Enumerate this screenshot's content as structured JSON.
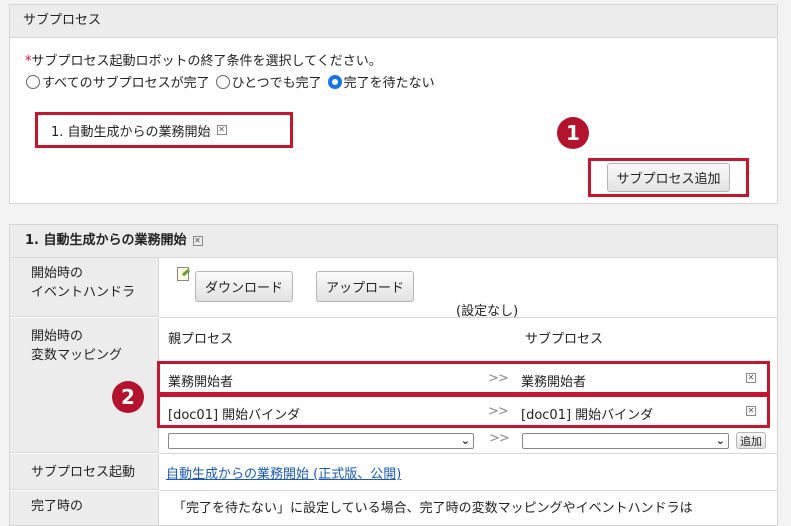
{
  "section1": {
    "title": "サブプロセス",
    "required_mark": "*",
    "prompt": "サブプロセス起動ロボットの終了条件を選択してください。",
    "radio_options": [
      {
        "label": "すべてのサブプロセスが完了",
        "checked": false
      },
      {
        "label": "ひとつでも完了",
        "checked": false
      },
      {
        "label": "完了を待たない",
        "checked": true
      }
    ],
    "listed_subprocess": "1. 自動生成からの業務開始",
    "add_button": "サブプロセス追加"
  },
  "badges": {
    "one": "1",
    "two": "2"
  },
  "section2": {
    "title": "1. 自動生成からの業務開始",
    "event_handler_label": "開始時の\nイベントハンドラ",
    "download_button": "ダウンロード",
    "upload_button": "アップロード",
    "no_setting": "(設定なし)",
    "mapping_label": "開始時の\n変数マッピング",
    "parent_header": "親プロセス",
    "sub_header": "サブプロセス",
    "mappings": [
      {
        "parent": "業務開始者",
        "arrow": ">>",
        "sub": "業務開始者"
      },
      {
        "parent": "[doc01] 開始バインダ",
        "arrow": ">>",
        "sub": "[doc01] 開始バインダ"
      }
    ],
    "new_mapping_arrow": ">>",
    "add_small_button": "追加",
    "launch_label": "サブプロセス起動",
    "launch_link": "自動生成からの業務開始 (正式版、公開)",
    "next_label_partial": "完了時の",
    "next_content_partial": "「完了を待たない」に設定している場合、完了時の変数マッピングやイベントハンドラは"
  },
  "icons": {
    "close": "close-x-icon",
    "pencil": "edit-note-icon",
    "dropdown": "chevron-down-icon"
  },
  "colors": {
    "highlight": "#c3172f",
    "badge": "#b3132d",
    "link": "#1a58b3",
    "radio_checked": "#1a73e8"
  }
}
